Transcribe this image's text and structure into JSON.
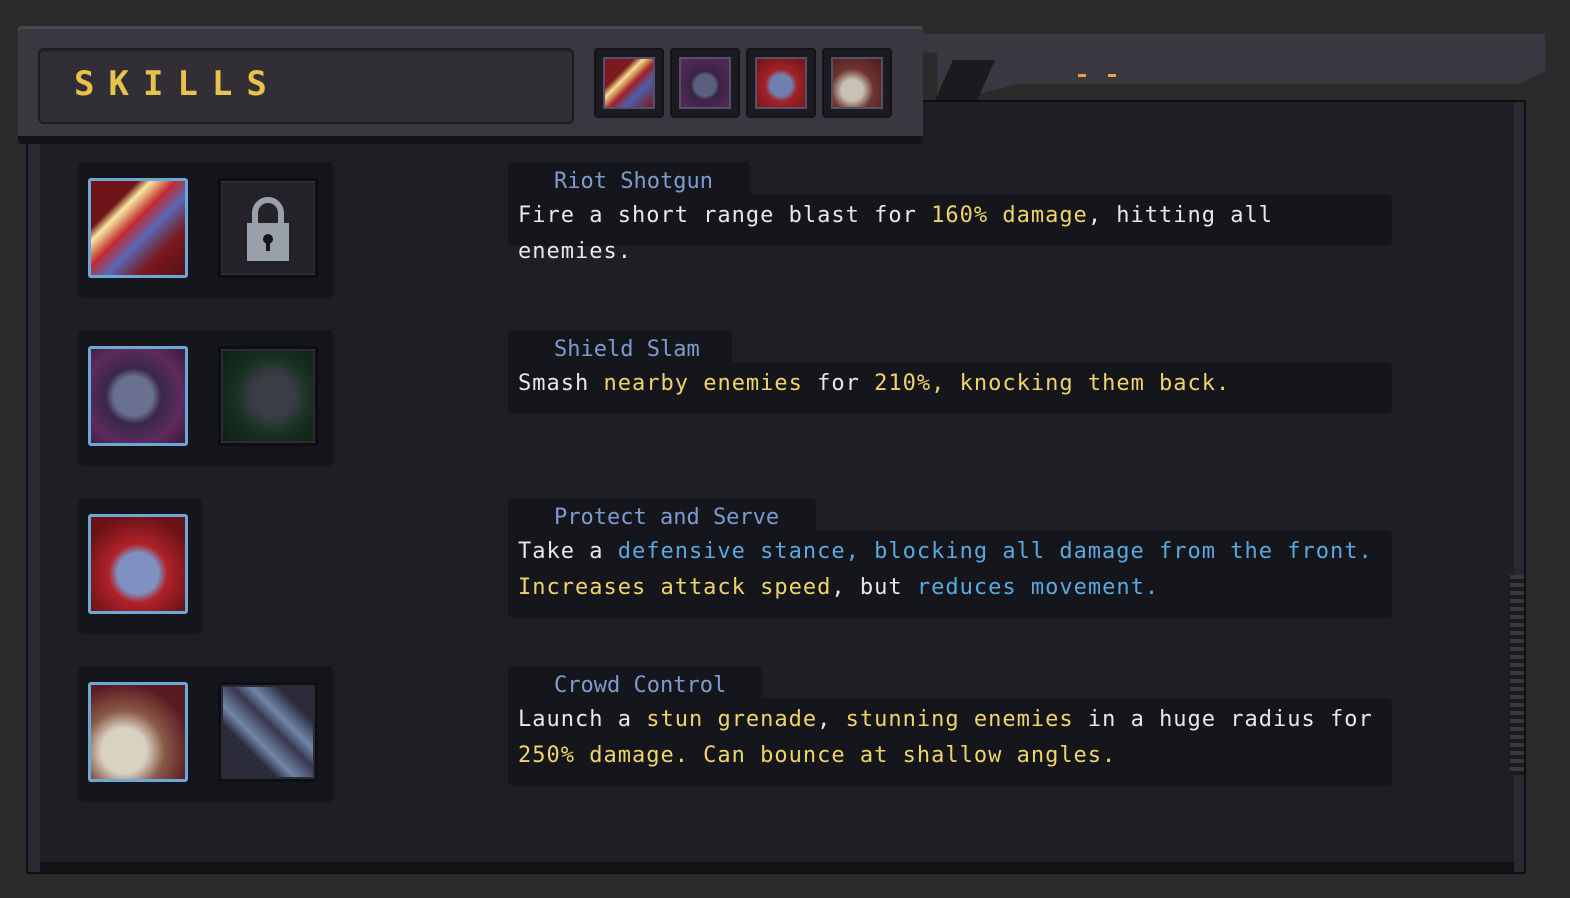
{
  "window": {
    "title": "SKILLS"
  },
  "tabs": [
    {
      "name": "riot-shotgun-tab",
      "icon": "shotgun-icon"
    },
    {
      "name": "shield-slam-tab",
      "icon": "shield-fist-icon"
    },
    {
      "name": "protect-and-serve-tab",
      "icon": "bucket-shield-icon"
    },
    {
      "name": "crowd-control-tab",
      "icon": "grenade-icon"
    }
  ],
  "skills": [
    {
      "name": "Riot Shotgun",
      "desc": [
        "Fire a short range blast for ",
        "160% damage",
        ", hitting all enemies."
      ],
      "slots": [
        "shotgun-icon",
        "lock-icon"
      ]
    },
    {
      "name": "Shield Slam",
      "desc": [
        "Smash ",
        "nearby enemies",
        " for ",
        "210%, knocking them back."
      ],
      "slots": [
        "shield-fist-icon",
        "shield-bash-alt-icon"
      ]
    },
    {
      "name": "Protect and Serve",
      "desc": [
        "Take a ",
        "defensive stance, blocking all damage from the front.",
        "Increases attack speed",
        ", but ",
        "reduces movement."
      ],
      "slots": [
        "bucket-shield-icon"
      ]
    },
    {
      "name": "Crowd Control",
      "desc": [
        "Launch a ",
        "stun grenade",
        ", ",
        "stunning enemies",
        " in a huge radius for ",
        "250% damage. Can bounce at shallow angles."
      ],
      "slots": [
        "grenade-icon",
        "spread-shot-icon"
      ]
    }
  ],
  "colors": {
    "accent": "#e8c24a",
    "highlight_yellow": "#f0d468",
    "highlight_blue": "#5aa8e0",
    "name_blue": "#7d9bd0"
  }
}
